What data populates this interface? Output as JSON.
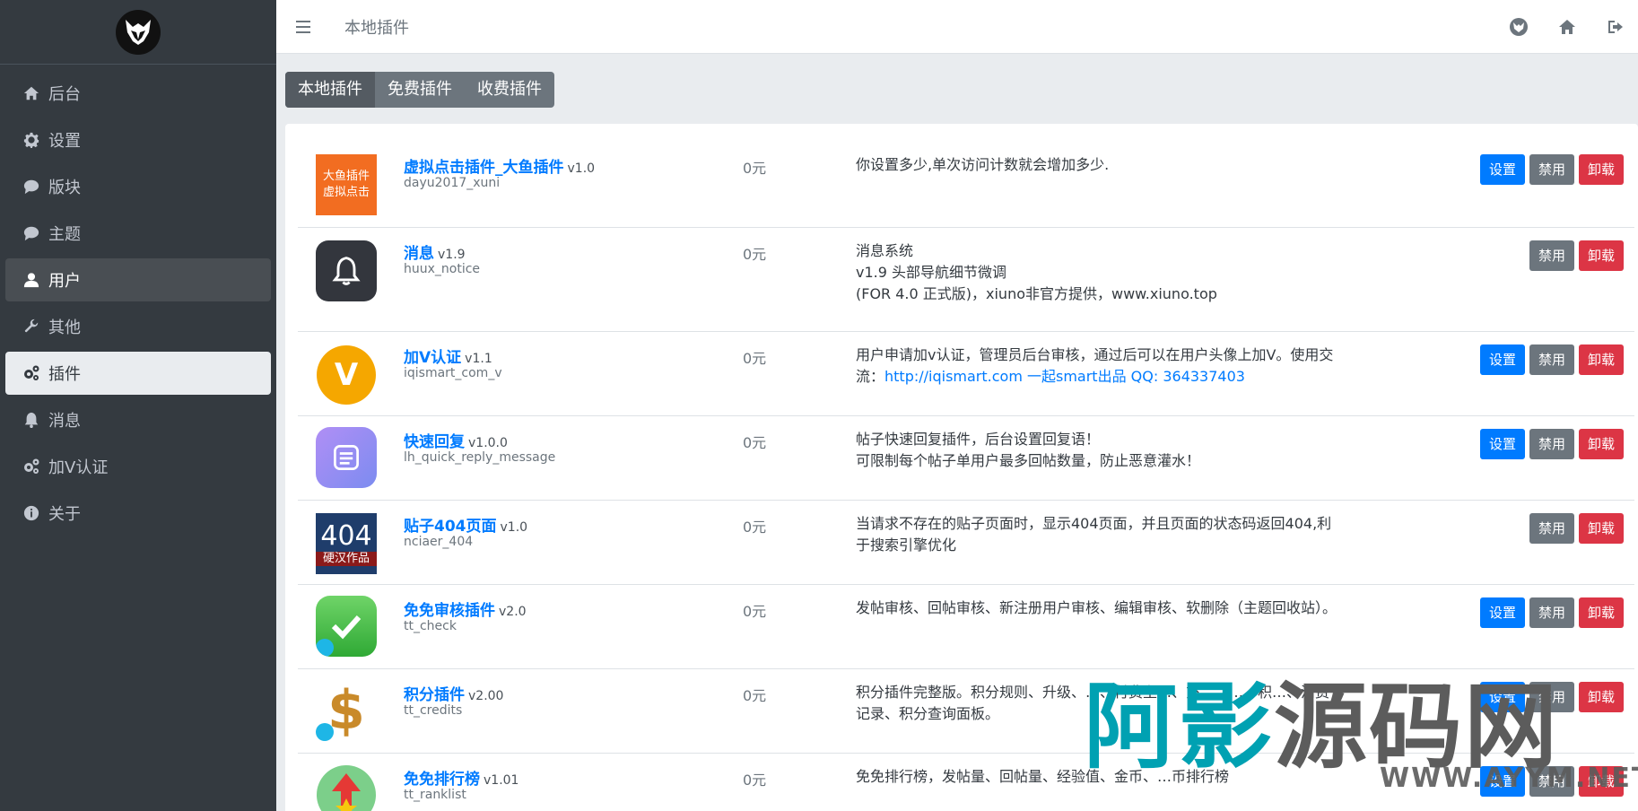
{
  "app": {
    "page_title": "本地插件"
  },
  "sidebar": {
    "items": [
      {
        "label": "后台",
        "icon": "home-icon"
      },
      {
        "label": "设置",
        "icon": "gear-icon"
      },
      {
        "label": "版块",
        "icon": "comment-icon"
      },
      {
        "label": "主题",
        "icon": "comments-icon"
      },
      {
        "label": "用户",
        "icon": "user-icon"
      },
      {
        "label": "其他",
        "icon": "wrench-icon"
      },
      {
        "label": "插件",
        "icon": "cogs-icon"
      },
      {
        "label": "消息",
        "icon": "bell-icon"
      },
      {
        "label": "加V认证",
        "icon": "cogs-icon"
      },
      {
        "label": "关于",
        "icon": "info-icon"
      }
    ]
  },
  "tabs": [
    {
      "label": "本地插件",
      "active": true
    },
    {
      "label": "免费插件",
      "active": false
    },
    {
      "label": "收费插件",
      "active": false
    }
  ],
  "buttons": {
    "settings": "设置",
    "disable": "禁用",
    "uninstall": "卸载"
  },
  "plugins": [
    {
      "name": "虚拟点击插件_大鱼插件",
      "version": "v1.0",
      "dir": "dayu2017_xuni",
      "price": "0元",
      "desc": [
        "你设置多少,单次访问计数就会增加多少."
      ],
      "has_settings": true,
      "thumb_text": [
        "大鱼插件",
        "虚拟点击"
      ]
    },
    {
      "name": "消息",
      "version": "v1.9",
      "dir": "huux_notice",
      "price": "0元",
      "desc": [
        "消息系统",
        "v1.9 头部导航细节微调",
        "(FOR 4.0 正式版)，xiuno非官方提供，www.xiuno.top"
      ],
      "has_settings": false
    },
    {
      "name": "加V认证",
      "version": "v1.1",
      "dir": "iqismart_com_v",
      "price": "0元",
      "desc_text": "用户申请加v认证，管理员后台审核，通过后可以在用户头像上加V。使用交流：",
      "desc_link": "http://iqismart.com 一起smart出品 QQ: 364337403",
      "has_settings": true,
      "thumb_text": [
        "V"
      ]
    },
    {
      "name": "快速回复",
      "version": "v1.0.0",
      "dir": "lh_quick_reply_message",
      "price": "0元",
      "desc": [
        "帖子快速回复插件，后台设置回复语！",
        "可限制每个帖子单用户最多回帖数量，防止恶意灌水！"
      ],
      "has_settings": true
    },
    {
      "name": "贴子404页面",
      "version": "v1.0",
      "dir": "nciaer_404",
      "price": "0元",
      "desc": [
        "当请求不存在的贴子页面时，显示404页面，并且页面的状态码返回404,利于搜索引擎优化"
      ],
      "has_settings": false,
      "thumb_text": [
        "404",
        "硬汉作品"
      ]
    },
    {
      "name": "免免审核插件",
      "version": "v2.0",
      "dir": "tt_check",
      "price": "0元",
      "desc": [
        "发帖审核、回帖审核、新注册用户审核、编辑审核、软删除（主题回收站）。"
      ],
      "has_settings": true
    },
    {
      "name": "积分插件",
      "version": "v2.00",
      "dir": "tt_credits",
      "price": "0元",
      "desc": [
        "积分插件完整版。积分规则、升级、…、付费主…、充…、…、积…、消费记录、积分查询面板。"
      ],
      "has_settings": true,
      "thumb_text": [
        "$"
      ]
    },
    {
      "name": "免免排行榜",
      "version": "v1.01",
      "dir": "tt_ranklist",
      "price": "0元",
      "desc": [
        "免免排行榜，发帖量、回帖量、经验值、金币、…币排行榜"
      ],
      "has_settings": true
    }
  ],
  "watermark": {
    "big_a": "阿影",
    "big_b": "源码网",
    "small": "WWW.AYYM.NET"
  },
  "colors": {
    "sidebar": "#343a40",
    "primary": "#007bff",
    "danger": "#dc3545",
    "secondary": "#6c757d"
  }
}
